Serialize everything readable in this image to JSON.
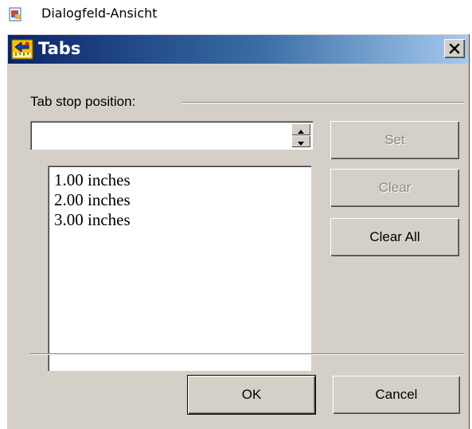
{
  "app": {
    "title": "Dialogfeld-Ansicht",
    "icon": "document-icon"
  },
  "dialog": {
    "title": "Tabs",
    "title_icon": "tabs-ruler-icon",
    "close_icon": "close-icon",
    "group_label": "Tab stop position:",
    "tab_stop_input": {
      "value": "",
      "placeholder": ""
    },
    "tab_stops": [
      "1.00 inches",
      "2.00 inches",
      "3.00 inches"
    ],
    "buttons": {
      "set": "Set",
      "clear": "Clear",
      "clear_all": "Clear All",
      "ok": "OK",
      "cancel": "Cancel"
    },
    "colors": {
      "face": "#d4d0c8",
      "titlebar_start": "#0a246a",
      "titlebar_end": "#a6caf0"
    }
  }
}
